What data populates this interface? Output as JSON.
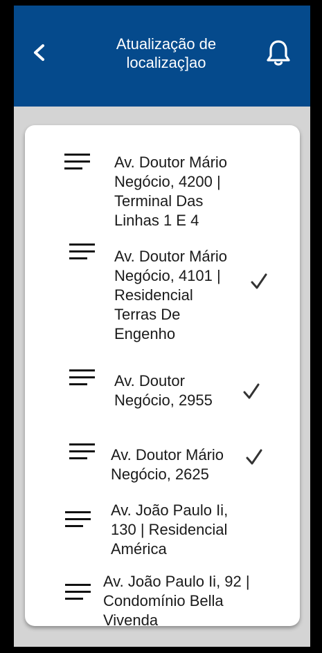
{
  "header": {
    "title": "Atualização de localizaç]ao",
    "back_icon": "chevron-left-icon",
    "notification_icon": "bell-icon",
    "background": "#054a8c"
  },
  "locations": [
    {
      "label": "Av. Doutor Mário\nNegócio, 4200 |\nTerminal Das\nLinhas 1 E 4",
      "checked": false
    },
    {
      "label": "Av. Doutor Mário\nNegócio, 4101 |\nResidencial\nTerras De\nEngenho",
      "checked": true
    },
    {
      "label": "Av. Doutor\nNegócio, 2955",
      "checked": true
    },
    {
      "label": "Av. Doutor Mário\nNegócio, 2625",
      "checked": true
    },
    {
      "label": "Av. João Paulo Ii,\n130 | Residencial\nAmérica",
      "checked": false
    },
    {
      "label": "Av. João Paulo Ii, 92 |\nCondomínio Bella\nVivenda",
      "checked": false
    }
  ]
}
